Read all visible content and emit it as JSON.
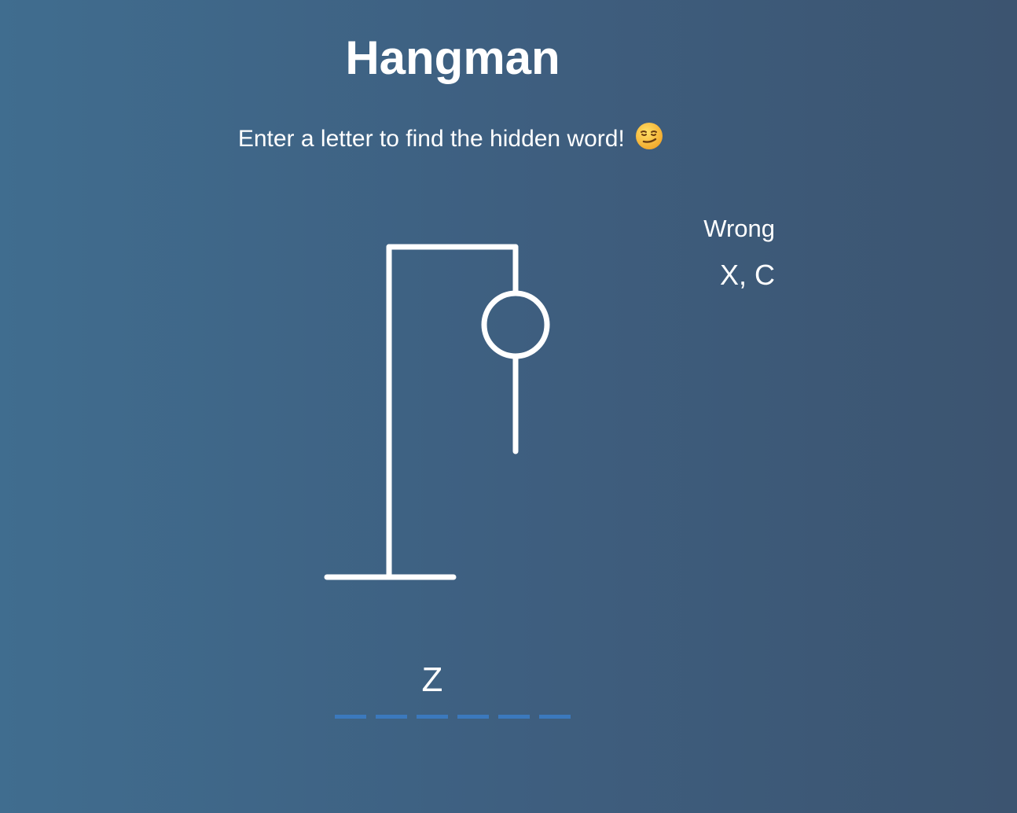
{
  "title": "Hangman",
  "subtitle": "Enter a letter to find the hidden word!",
  "subtitle_emoji": "smirking-face-icon",
  "wrong": {
    "label": "Wrong",
    "letters": "X, C"
  },
  "word": {
    "slots": [
      "",
      "",
      "Z",
      "",
      "",
      ""
    ]
  },
  "colors": {
    "figure": "#ffffff",
    "slot_underline": "#3b79bd",
    "emoji": "#f6c23e"
  }
}
